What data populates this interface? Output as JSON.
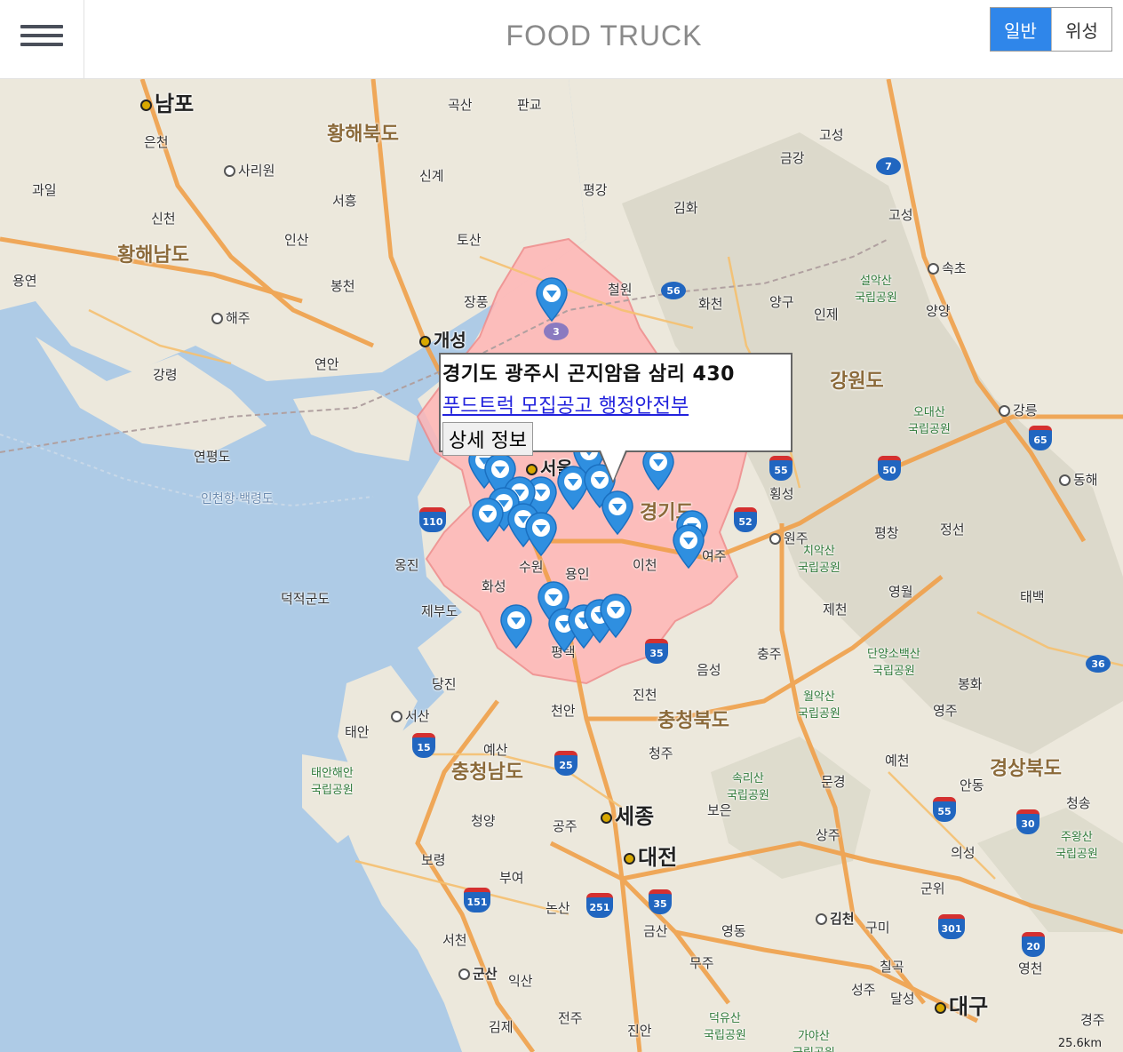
{
  "header": {
    "title": "FOOD TRUCK",
    "map_type_normal": "일반",
    "map_type_satellite": "위성"
  },
  "map": {
    "colors": {
      "sea": "#aecbe6",
      "land": "#ece8dc",
      "highlight": "#ffb6b6",
      "road": "#f0a04a",
      "pin": "#2f8fe0"
    },
    "labels": {
      "nampo": "남포",
      "hwanghaebukdo": "황해북도",
      "eunchon": "은천",
      "sariwon": "사리원",
      "gwail": "과일",
      "sincheon": "신천",
      "hwanghaenamdo": "황해남도",
      "insan": "인산",
      "seoheung": "서흥",
      "singye": "신계",
      "goksan": "곡산",
      "pangyo": "판교",
      "pyeonggang": "평강",
      "gimhwa": "김화",
      "geumgang": "금강",
      "goseong1": "고성",
      "goseong2": "고성",
      "sokcho": "속초",
      "seoraksan": "설악산\n국립공원",
      "yangyang": "양양",
      "yongyeon": "용연",
      "haeju": "해주",
      "bongcheon": "봉천",
      "tosan": "토산",
      "jangpung": "장풍",
      "gaeseong": "개성",
      "cheorwon": "철원",
      "hwacheon": "화천",
      "yanggu": "양구",
      "inje": "인제",
      "gangryeong": "강령",
      "yeonan": "연안",
      "gangwondo": "강원도",
      "odaesan": "오대산\n국립공원",
      "gangneung": "강릉",
      "yeonpyeongdo": "연평도",
      "incheon_sea": "인천항·백령도",
      "seoul": "서울",
      "donghae": "동해",
      "hoengseong": "횡성",
      "gyeonggido": "경기도",
      "wonju": "원주",
      "chiaksan": "치악산\n국립공원",
      "pyeongchang": "평창",
      "jeongseon": "정선",
      "ongjin": "옹진",
      "deokjeokgundo": "덕적군도",
      "suwon": "수원",
      "yongin": "용인",
      "icheon": "이천",
      "yeoju": "여주",
      "hwaseong": "화성",
      "jebudo": "제부도",
      "yeongwol": "영월",
      "jecheon": "제천",
      "taebaek": "태백",
      "pyeongtaek": "평택",
      "chungju": "충주",
      "danyang": "단양소백산\n국립공원",
      "bonghwa": "봉화",
      "dangjin": "당진",
      "eumseong": "음성",
      "jincheon": "진천",
      "cheonan": "천안",
      "seosan": "서산",
      "taean": "태안",
      "chungcheongbukdo": "충청북도",
      "woraksan": "월악산\n국립공원",
      "yeongju": "영주",
      "taeanhaean": "태안해안\n국립공원",
      "yesan": "예산",
      "chungcheongnamdo": "충청남도",
      "cheongju": "청주",
      "songnisan": "속리산\n국립공원",
      "mungyeong": "문경",
      "yecheon": "예천",
      "andong": "안동",
      "gyeongsangbukdo": "경상북도",
      "cheongyang": "청양",
      "gongju": "공주",
      "sejong": "세종",
      "boeun": "보은",
      "sangju": "상주",
      "uiseong": "의성",
      "cheongsong": "청송",
      "juwangsan": "주왕산\n국립공원",
      "boryeong": "보령",
      "daejeon": "대전",
      "buyeo": "부여",
      "gunwi": "군위",
      "nonsan": "논산",
      "geumsan": "금산",
      "yeongdong": "영동",
      "gimcheon": "김천",
      "gumi": "구미",
      "seocheon": "서천",
      "gunsan": "군산",
      "iksan": "익산",
      "muju": "무주",
      "chilgok": "칠곡",
      "yeongcheon": "영천",
      "gimje": "김제",
      "jeonju": "전주",
      "jinan": "진안",
      "deogyusan": "덕유산\n국립공원",
      "gayasan": "가야산\n국립공원",
      "seongju": "성주",
      "dalseong": "달성",
      "daegu": "대구",
      "gyeongju": "경주"
    },
    "route_numbers": [
      "7",
      "56",
      "55",
      "50",
      "65",
      "110",
      "52",
      "35",
      "15",
      "25",
      "151",
      "251",
      "35",
      "55",
      "30",
      "301",
      "20",
      "36",
      "3"
    ],
    "scale": "25.6km"
  },
  "popup": {
    "address": "경기도 광주시 곤지암읍 삼리 430",
    "link_text": "푸드트럭 모집공고 행정안전부",
    "detail_button": "상세 정보"
  }
}
